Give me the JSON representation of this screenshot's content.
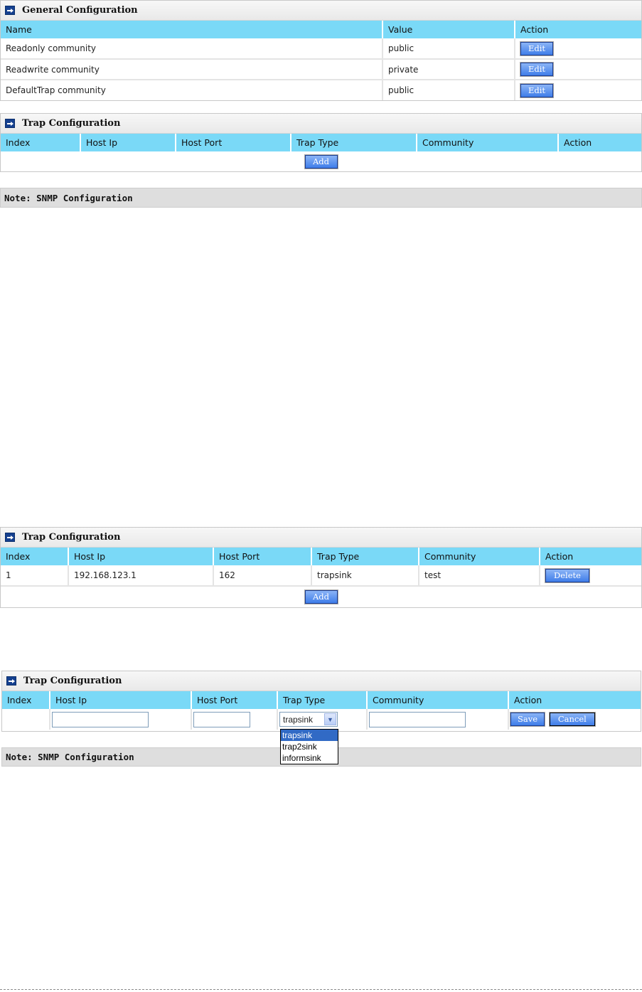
{
  "general": {
    "title": "General Configuration",
    "headers": [
      "Name",
      "Value",
      "Action"
    ],
    "rows": [
      {
        "name": "Readonly community",
        "value": "public",
        "action": "Edit"
      },
      {
        "name": "Readwrite community",
        "value": "private",
        "action": "Edit"
      },
      {
        "name": "DefaultTrap community",
        "value": "public",
        "action": "Edit"
      }
    ]
  },
  "trap1": {
    "title": "Trap Configuration",
    "headers": [
      "Index",
      "Host Ip",
      "Host Port",
      "Trap Type",
      "Community",
      "Action"
    ],
    "add_label": "Add"
  },
  "note1": {
    "text": "Note: SNMP Configuration"
  },
  "trap2": {
    "title": "Trap Configuration",
    "headers": [
      "Index",
      "Host Ip",
      "Host Port",
      "Trap Type",
      "Community",
      "Action"
    ],
    "rows": [
      {
        "index": "1",
        "host_ip": "192.168.123.1",
        "host_port": "162",
        "trap_type": "trapsink",
        "community": "test",
        "action": "Delete"
      }
    ],
    "add_label": "Add"
  },
  "trap3": {
    "title": "Trap Configuration",
    "headers": [
      "Index",
      "Host Ip",
      "Host Port",
      "Trap Type",
      "Community",
      "Action"
    ],
    "host_ip_value": "",
    "host_port_value": "",
    "community_value": "",
    "trap_type_selected": "trapsink",
    "trap_type_options": [
      "trapsink",
      "trap2sink",
      "informsink"
    ],
    "save_label": "Save",
    "cancel_label": "Cancel"
  },
  "note2": {
    "text": "Note: SNMP Configuration"
  },
  "colors": {
    "header_bg": "#7ad9f7",
    "button_blue": "#3f7de9",
    "selected_option": "#316ac5"
  }
}
